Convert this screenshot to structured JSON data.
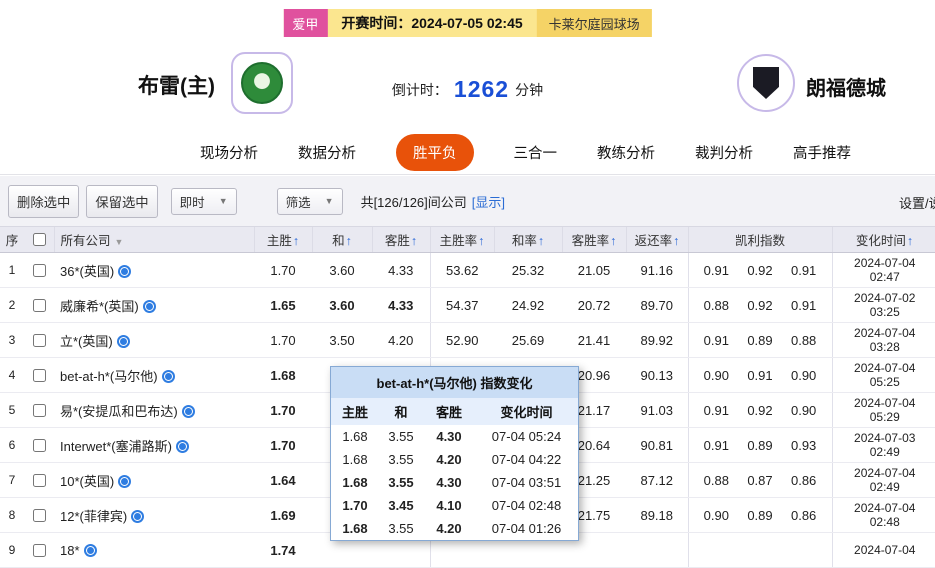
{
  "header": {
    "league": "爱甲",
    "kickoff": "开赛时间：2024-07-05 02:45",
    "venue": "卡莱尔庭园球场",
    "home_team": "布雷(主)",
    "away_team": "朗福德城",
    "countdown_label": "倒计时：",
    "countdown_value": "1262",
    "countdown_unit": "分钟"
  },
  "nav": {
    "items": [
      {
        "label": "现场分析",
        "active": false
      },
      {
        "label": "数据分析",
        "active": false
      },
      {
        "label": "胜平负",
        "active": true
      },
      {
        "label": "三合一",
        "active": false
      },
      {
        "label": "教练分析",
        "active": false
      },
      {
        "label": "裁判分析",
        "active": false
      },
      {
        "label": "高手推荐",
        "active": false
      }
    ]
  },
  "toolbar": {
    "delete_selected": "删除选中",
    "keep_selected": "保留选中",
    "live_dropdown": "即时",
    "filter_dropdown": "筛选",
    "company_count": "共[126/126]间公司",
    "show_link": "[显示]",
    "settings_link": "设置/说明"
  },
  "table": {
    "headers": {
      "seq": "序",
      "company": "所有公司",
      "home": "主胜",
      "draw": "和",
      "away": "客胜",
      "home_rate": "主胜率",
      "draw_rate": "和率",
      "away_rate": "客胜率",
      "payout": "返还率",
      "kelly": "凯利指数",
      "time": "变化时间"
    },
    "rows": [
      {
        "seq": "1",
        "company": "36*(英国)",
        "home": {
          "v": "1.70",
          "c": ""
        },
        "draw": {
          "v": "3.60",
          "c": ""
        },
        "away": {
          "v": "4.33",
          "c": ""
        },
        "home_rate": "53.62",
        "draw_rate": "25.32",
        "away_rate": "21.05",
        "payout": "91.16",
        "kelly": [
          "0.91",
          "0.92",
          "0.91"
        ],
        "date": "2024-07-04",
        "time": "02:47"
      },
      {
        "seq": "2",
        "company": "威廉希*(英国)",
        "home": {
          "v": "1.65",
          "c": "g"
        },
        "draw": {
          "v": "3.60",
          "c": "r"
        },
        "away": {
          "v": "4.33",
          "c": "g"
        },
        "home_rate": "54.37",
        "draw_rate": "24.92",
        "away_rate": "20.72",
        "payout": "89.70",
        "kelly": [
          "0.88",
          "0.92",
          "0.91"
        ],
        "date": "2024-07-02",
        "time": "03:25"
      },
      {
        "seq": "3",
        "company": "立*(英国)",
        "home": {
          "v": "1.70",
          "c": ""
        },
        "draw": {
          "v": "3.50",
          "c": ""
        },
        "away": {
          "v": "4.20",
          "c": ""
        },
        "home_rate": "52.90",
        "draw_rate": "25.69",
        "away_rate": "21.41",
        "payout": "89.92",
        "kelly": [
          "0.91",
          "0.89",
          "0.88"
        ],
        "date": "2024-07-04",
        "time": "03:28"
      },
      {
        "seq": "4",
        "company": "bet-at-h*(马尔他)",
        "home": {
          "v": "1.68",
          "c": "g"
        },
        "draw": {
          "v": "",
          "c": ""
        },
        "away": {
          "v": "",
          "c": ""
        },
        "home_rate": "",
        "draw_rate": "",
        "away_rate": "20.96",
        "payout": "90.13",
        "kelly": [
          "0.90",
          "0.91",
          "0.90"
        ],
        "date": "2024-07-04",
        "time": "05:25"
      },
      {
        "seq": "5",
        "company": "易*(安提瓜和巴布达)",
        "home": {
          "v": "1.70",
          "c": "r"
        },
        "draw": {
          "v": "",
          "c": ""
        },
        "away": {
          "v": "",
          "c": ""
        },
        "home_rate": "",
        "draw_rate": "",
        "away_rate": "21.17",
        "payout": "91.03",
        "kelly": [
          "0.91",
          "0.92",
          "0.90"
        ],
        "date": "2024-07-04",
        "time": "05:29"
      },
      {
        "seq": "6",
        "company": "Interwet*(塞浦路斯)",
        "home": {
          "v": "1.70",
          "c": "g"
        },
        "draw": {
          "v": "",
          "c": ""
        },
        "away": {
          "v": "",
          "c": ""
        },
        "home_rate": "",
        "draw_rate": "",
        "away_rate": "20.64",
        "payout": "90.81",
        "kelly": [
          "0.91",
          "0.89",
          "0.93"
        ],
        "date": "2024-07-03",
        "time": "02:49"
      },
      {
        "seq": "7",
        "company": "10*(英国)",
        "home": {
          "v": "1.64",
          "c": "g"
        },
        "draw": {
          "v": "",
          "c": ""
        },
        "away": {
          "v": "",
          "c": ""
        },
        "home_rate": "",
        "draw_rate": "",
        "away_rate": "21.25",
        "payout": "87.12",
        "kelly": [
          "0.88",
          "0.87",
          "0.86"
        ],
        "date": "2024-07-04",
        "time": "02:49"
      },
      {
        "seq": "8",
        "company": "12*(菲律宾)",
        "home": {
          "v": "1.69",
          "c": "r"
        },
        "draw": {
          "v": "",
          "c": ""
        },
        "away": {
          "v": "",
          "c": ""
        },
        "home_rate": "",
        "draw_rate": "",
        "away_rate": "21.75",
        "payout": "89.18",
        "kelly": [
          "0.90",
          "0.89",
          "0.86"
        ],
        "date": "2024-07-04",
        "time": "02:48"
      },
      {
        "seq": "9",
        "company": "18*",
        "home": {
          "v": "1.74",
          "c": "r"
        },
        "draw": {
          "v": "",
          "c": ""
        },
        "away": {
          "v": "",
          "c": ""
        },
        "home_rate": "",
        "draw_rate": "",
        "away_rate": "",
        "payout": "",
        "kelly": [
          "",
          "",
          ""
        ],
        "date": "2024-07-04",
        "time": ""
      }
    ]
  },
  "popup": {
    "title": "bet-at-h*(马尔他) 指数变化",
    "headers": [
      "主胜",
      "和",
      "客胜",
      "变化时间"
    ],
    "rows": [
      {
        "home": {
          "v": "1.68",
          "c": ""
        },
        "draw": {
          "v": "3.55",
          "c": ""
        },
        "away": {
          "v": "4.30",
          "c": "r"
        },
        "time": "07-04 05:24"
      },
      {
        "home": {
          "v": "1.68",
          "c": ""
        },
        "draw": {
          "v": "3.55",
          "c": ""
        },
        "away": {
          "v": "4.20",
          "c": "g"
        },
        "time": "07-04 04:22"
      },
      {
        "home": {
          "v": "1.68",
          "c": "g"
        },
        "draw": {
          "v": "3.55",
          "c": "r"
        },
        "away": {
          "v": "4.30",
          "c": "r"
        },
        "time": "07-04 03:51"
      },
      {
        "home": {
          "v": "1.70",
          "c": "r"
        },
        "draw": {
          "v": "3.45",
          "c": "g"
        },
        "away": {
          "v": "4.10",
          "c": "g"
        },
        "time": "07-04 02:48"
      },
      {
        "home": {
          "v": "1.68",
          "c": "g"
        },
        "draw": {
          "v": "3.55",
          "c": ""
        },
        "away": {
          "v": "4.20",
          "c": "g"
        },
        "time": "07-04 01:26"
      }
    ]
  },
  "icons": {
    "sort_arrow": "↑",
    "caret": "▼"
  },
  "colors": {
    "accent_active_tab": "#e8520a",
    "odds_up_red": "#e12b2b",
    "odds_down_green": "#11a012",
    "link_blue": "#2b6cd4",
    "countdown_blue": "#1a4fd6",
    "strip_yellow": "#fbe68f",
    "league_pink": "#e0519e"
  }
}
